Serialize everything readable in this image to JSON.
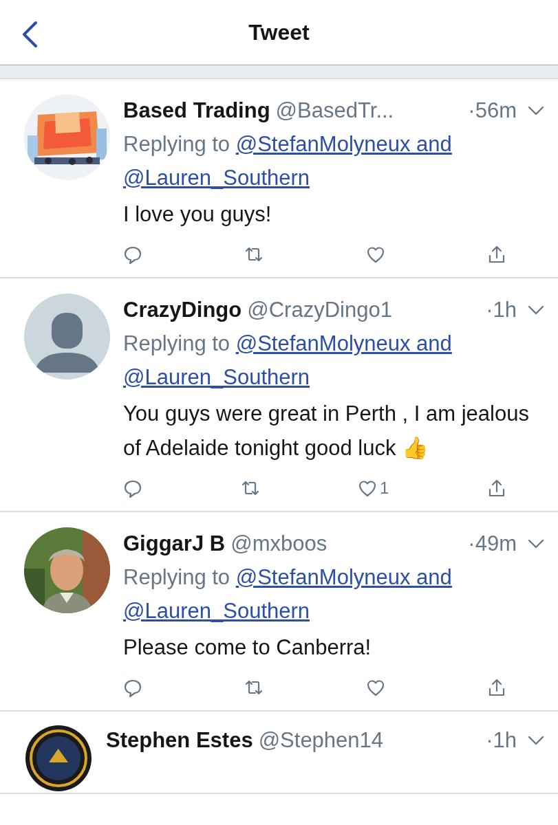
{
  "header": {
    "title": "Tweet"
  },
  "tweets": [
    {
      "name": "Based Trading",
      "handle": "@BasedTr...",
      "time": "·56m",
      "replying_label": "Replying to",
      "mentions": [
        "@StefanMolyneux and",
        "@Lauren_Southern"
      ],
      "text": "I love you guys!"
    },
    {
      "avatar": {
        "kind": "silhouette"
      },
      "name": "CrazyDingo",
      "handle": "@CrazyDingo1",
      "time": "·1h",
      "replying_label": "Replying to",
      "mentions": [
        "@StefanMolyneux and",
        "@Lauren_Southern"
      ],
      "text": "You guys were great in Perth , I am jealous of Adelaide tonight good luck 👍",
      "like_count": "1"
    },
    {
      "name": "GiggarJ B",
      "handle": "@mxboos",
      "time": "·49m",
      "replying_label": "Replying to",
      "mentions": [
        "@StefanMolyneux and",
        "@Lauren_Southern"
      ],
      "text": "Please come to Canberra!"
    },
    {
      "name": "Stephen Estes",
      "handle": "@Stephen14",
      "time": "·1h"
    }
  ]
}
